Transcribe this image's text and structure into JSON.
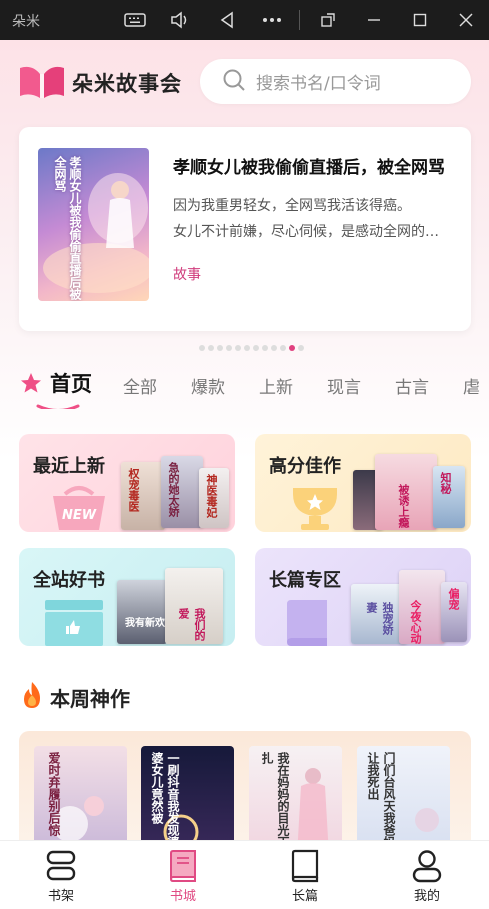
{
  "window": {
    "title": "朵米",
    "controls": [
      "keyboard-icon",
      "volume-icon",
      "back-icon",
      "more-icon",
      "rotate-icon",
      "minimize-icon",
      "maximize-icon",
      "close-icon"
    ]
  },
  "header": {
    "brand": "朵米故事会",
    "search_placeholder": "搜索书名/口令词"
  },
  "banner": {
    "cover_text": "孝顺女儿被我偷偷直播后被全网骂",
    "title": "孝顺女儿被我偷偷直播后，被全网骂",
    "desc_line1": "因为我重男轻女，全网骂我活该得癌。",
    "desc_line2": "女儿不计前嫌，尽心伺候，是感动全网的孝顺女儿。",
    "tag": "故事",
    "dot_count": 12,
    "active_dot": 10
  },
  "tabs": [
    {
      "label": "首页",
      "active": true
    },
    {
      "label": "全部",
      "active": false
    },
    {
      "label": "爆款",
      "active": false
    },
    {
      "label": "上新",
      "active": false
    },
    {
      "label": "现言",
      "active": false
    },
    {
      "label": "古言",
      "active": false
    },
    {
      "label": "虐",
      "active": false
    }
  ],
  "categories": [
    {
      "label": "最近上新",
      "badge": "NEW",
      "covers": [
        "权宠毒医",
        "急的她太娇",
        "神医毒妃"
      ]
    },
    {
      "label": "高分佳作",
      "covers": [
        "被诱上瘾",
        "知秘"
      ]
    },
    {
      "label": "全站好书",
      "covers": [
        "我有新欢",
        "我们的爱"
      ]
    },
    {
      "label": "长篇专区",
      "covers": [
        "独宠娇妻",
        "今夜心动",
        "偏宠"
      ]
    }
  ],
  "weekly": {
    "title": "本周神作",
    "books": [
      {
        "title": "爱时弃履别后惊"
      },
      {
        "title": "一刷抖音我发现婆婆女儿竟然被"
      },
      {
        "title": "我在妈妈的目光下扎"
      },
      {
        "title": "门们台风天我爸妈让我死出"
      }
    ]
  },
  "bottom_nav": [
    {
      "label": "书架",
      "icon": "bookshelf-icon",
      "active": false
    },
    {
      "label": "书城",
      "icon": "bookstore-icon",
      "active": true
    },
    {
      "label": "长篇",
      "icon": "book-icon",
      "active": false
    },
    {
      "label": "我的",
      "icon": "profile-icon",
      "active": false
    }
  ],
  "colors": {
    "accent": "#e04a83",
    "header_bg": "#fde2e7"
  }
}
